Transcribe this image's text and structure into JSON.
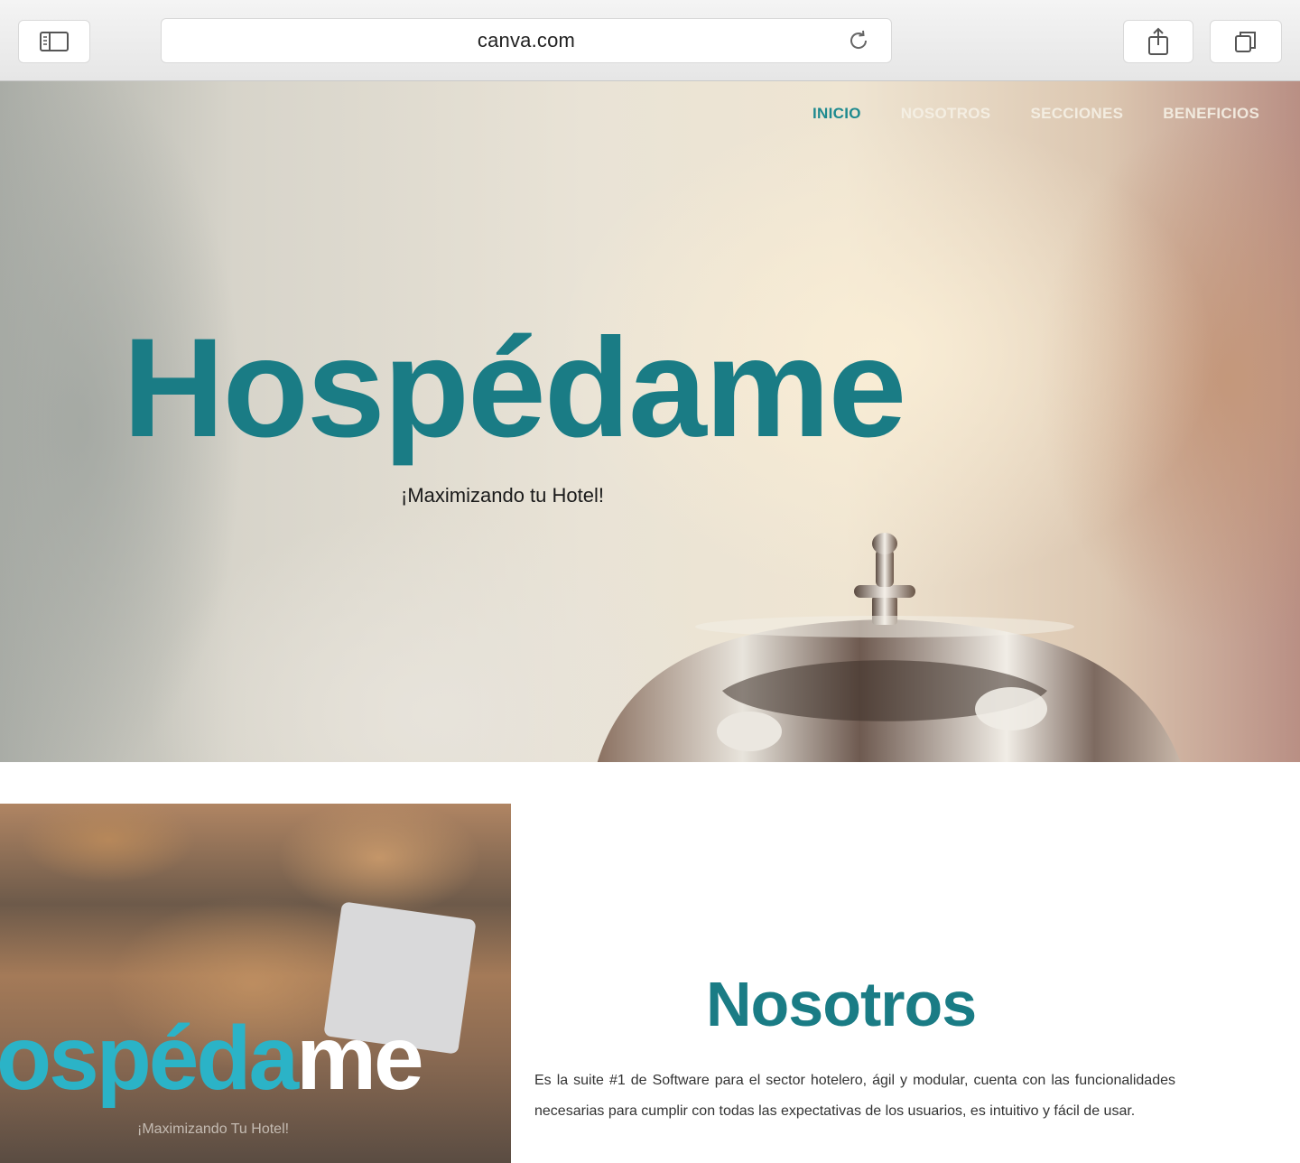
{
  "browser": {
    "url": "canva.com"
  },
  "nav": {
    "items": [
      "INICIO",
      "NOSOTROS",
      "SECCIONES",
      "BENEFICIOS"
    ],
    "active_color": "#1e8a8f"
  },
  "hero": {
    "title": "Hospédame",
    "subtitle": "¡Maximizando tu Hotel!",
    "title_color": "#1a7c85"
  },
  "promo": {
    "logo_main": "ospéda",
    "logo_end": "me",
    "tagline": "¡Maximizando Tu Hotel!",
    "logo_color": "#2bb3c7"
  },
  "about": {
    "title": "Nosotros",
    "text": "Es la suite #1 de Software para el sector hotelero, ágil y modular, cuenta con las funcionalidades necesarias para cumplir con todas las expectativas de los usuarios, es intuitivo y fácil de usar."
  }
}
